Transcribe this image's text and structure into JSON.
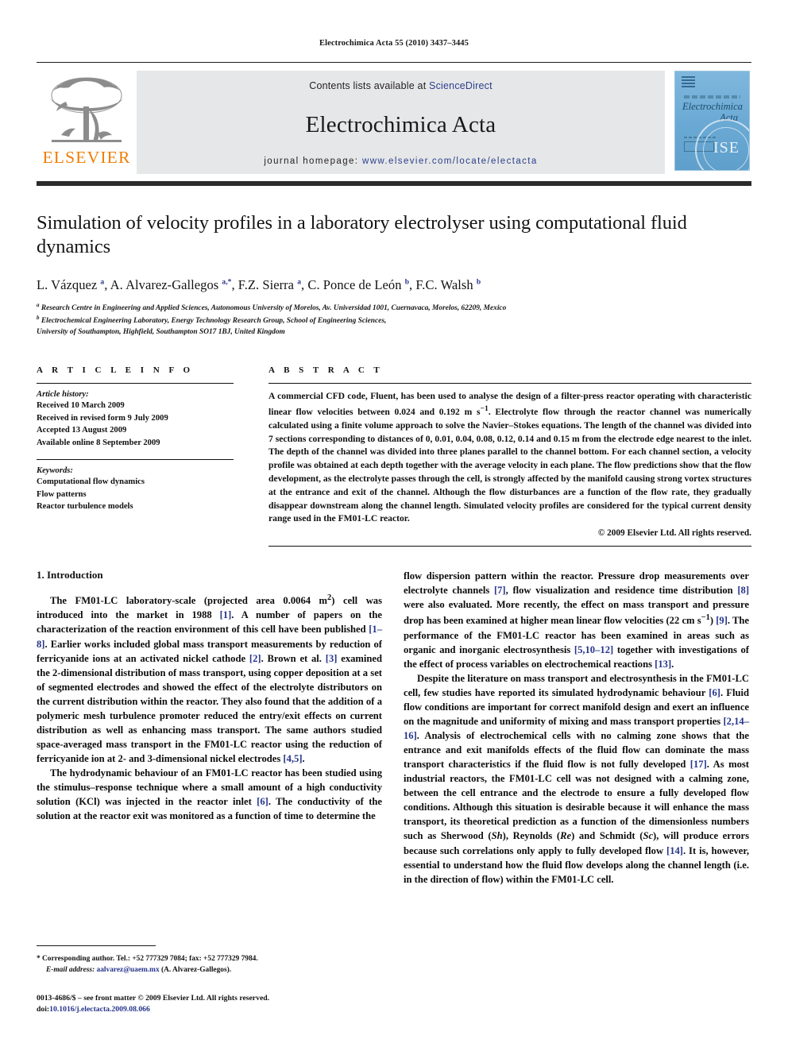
{
  "running_head": "Electrochimica Acta 55 (2010) 3437–3445",
  "masthead": {
    "contents_prefix": "Contents lists available at ",
    "sciencedirect": "ScienceDirect",
    "journal_title": "Electrochimica Acta",
    "homepage_prefix": "journal homepage: ",
    "homepage_url": "www.elsevier.com/locate/electacta",
    "publisher_logo_text": "ELSEVIER",
    "cover_title_line1": "Electrochimica",
    "cover_title_line2": "Acta",
    "cover_seal_text": "ISE",
    "accent_link_color": "#2b3f8c",
    "elsevier_orange": "#ef7d00",
    "cover_blue": "#6aa9d4"
  },
  "article": {
    "title": "Simulation of velocity profiles in a laboratory electrolyser using computational fluid dynamics",
    "authors_html": "L. Vázquez <sup>a</sup>, A. Alvarez-Gallegos <sup>a,*</sup>, F.Z. Sierra <sup>a</sup>, C. Ponce de León <sup>b</sup>, F.C. Walsh <sup>b</sup>",
    "affiliations": [
      "a Research Centre in Engineering and Applied Sciences, Autonomous University of Morelos, Av. Universidad 1001, Cuernavaca, Morelos, 62209, Mexico",
      "b Electrochemical Engineering Laboratory, Energy Technology Research Group, School of Engineering Sciences,",
      "University of Southampton, Highfield, Southampton SO17 1BJ, United Kingdom"
    ]
  },
  "article_info": {
    "heading": "A R T I C L E    I N F O",
    "history_label": "Article history:",
    "history": [
      "Received 10 March 2009",
      "Received in revised form 9 July 2009",
      "Accepted 13 August 2009",
      "Available online 8 September 2009"
    ],
    "keywords_label": "Keywords:",
    "keywords": [
      "Computational flow dynamics",
      "Flow patterns",
      "Reactor turbulence models"
    ]
  },
  "abstract": {
    "heading": "A B S T R A C T",
    "text": "A commercial CFD code, Fluent, has been used to analyse the design of a filter-press reactor operating with characteristic linear flow velocities between 0.024 and 0.192 m s−1. Electrolyte flow through the reactor channel was numerically calculated using a finite volume approach to solve the Navier–Stokes equations. The length of the channel was divided into 7 sections corresponding to distances of 0, 0.01, 0.04, 0.08, 0.12, 0.14 and 0.15 m from the electrode edge nearest to the inlet. The depth of the channel was divided into three planes parallel to the channel bottom. For each channel section, a velocity profile was obtained at each depth together with the average velocity in each plane. The flow predictions show that the flow development, as the electrolyte passes through the cell, is strongly affected by the manifold causing strong vortex structures at the entrance and exit of the channel. Although the flow disturbances are a function of the flow rate, they gradually disappear downstream along the channel length. Simulated velocity profiles are considered for the typical current density range used in the FM01-LC reactor.",
    "copyright": "© 2009 Elsevier Ltd. All rights reserved."
  },
  "sections": {
    "intro_heading": "1. Introduction",
    "left_paragraphs": [
      "The FM01-LC laboratory-scale (projected area 0.0064 m2) cell was introduced into the market in 1988 [1]. A number of papers on the characterization of the reaction environment of this cell have been published [1–8]. Earlier works included global mass transport measurements by reduction of ferricyanide ions at an activated nickel cathode [2]. Brown et al. [3] examined the 2-dimensional distribution of mass transport, using copper deposition at a set of segmented electrodes and showed the effect of the electrolyte distributors on the current distribution within the reactor. They also found that the addition of a polymeric mesh turbulence promoter reduced the entry/exit effects on current distribution as well as enhancing mass transport. The same authors studied space-averaged mass transport in the FM01-LC reactor using the reduction of ferricyanide ion at 2- and 3-dimensional nickel electrodes [4,5].",
      "The hydrodynamic behaviour of an FM01-LC reactor has been studied using the stimulus–response technique where a small amount of a high conductivity solution (KCl) was injected in the reactor inlet [6]. The conductivity of the solution at the reactor exit was monitored as a function of time to determine the"
    ],
    "right_paragraphs": [
      "flow dispersion pattern within the reactor. Pressure drop measurements over electrolyte channels [7], flow visualization and residence time distribution [8] were also evaluated. More recently, the effect on mass transport and pressure drop has been examined at higher mean linear flow velocities (22 cm s−1) [9]. The performance of the FM01-LC reactor has been examined in areas such as organic and inorganic electrosynthesis [5,10–12] together with investigations of the effect of process variables on electrochemical reactions [13].",
      "Despite the literature on mass transport and electrosynthesis in the FM01-LC cell, few studies have reported its simulated hydrodynamic behaviour [6]. Fluid flow conditions are important for correct manifold design and exert an influence on the magnitude and uniformity of mixing and mass transport properties [2,14–16]. Analysis of electrochemical cells with no calming zone shows that the entrance and exit manifolds effects of the fluid flow can dominate the mass transport characteristics if the fluid flow is not fully developed [17]. As most industrial reactors, the FM01-LC cell was not designed with a calming zone, between the cell entrance and the electrode to ensure a fully developed flow conditions. Although this situation is desirable because it will enhance the mass transport, its theoretical prediction as a function of the dimensionless numbers such as Sherwood (Sh), Reynolds (Re) and Schmidt (Sc), will produce errors because such correlations only apply to fully developed flow [14]. It is, however, essential to understand how the fluid flow develops along the channel length (i.e. in the direction of flow) within the FM01-LC cell."
    ]
  },
  "footnotes": {
    "corresponding_marker": "*",
    "corresponding_text": "Corresponding author. Tel.: +52 777329 7084; fax: +52 777329 7984.",
    "email_label": "E-mail address:",
    "email": "aalvarez@uaem.mx",
    "email_suffix": "(A. Alvarez-Gallegos).",
    "issn_line": "0013-4686/$ – see front matter © 2009 Elsevier Ltd. All rights reserved.",
    "doi_prefix": "doi:",
    "doi": "10.1016/j.electacta.2009.08.066"
  }
}
